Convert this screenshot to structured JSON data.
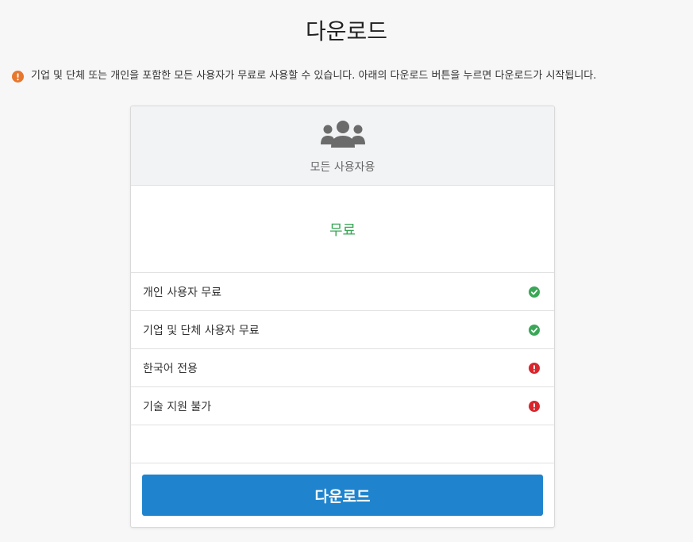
{
  "page": {
    "title": "다운로드",
    "notice": "기업 및 단체 또는 개인을 포함한 모든 사용자가 무료로 사용할 수 있습니다. 아래의 다운로드 버튼을 누르면 다운로드가 시작됩니다."
  },
  "card": {
    "plan_name": "모든 사용자용",
    "price": "무료",
    "features": [
      {
        "label": "개인 사용자 무료",
        "status": "check-icon"
      },
      {
        "label": "기업 및 단체 사용자 무료",
        "status": "check-icon"
      },
      {
        "label": "한국어 전용",
        "status": "exclamation-icon"
      },
      {
        "label": "기술 지원 불가",
        "status": "exclamation-icon"
      }
    ],
    "download_label": "다운로드"
  },
  "colors": {
    "warning_orange": "#e8772e",
    "success_green": "#3aa757",
    "danger_red": "#d9262c",
    "button_blue": "#1f84cd",
    "icon_gray": "#6b6b6b"
  },
  "icons": {
    "notice": "warning-icon",
    "header": "users-icon"
  }
}
